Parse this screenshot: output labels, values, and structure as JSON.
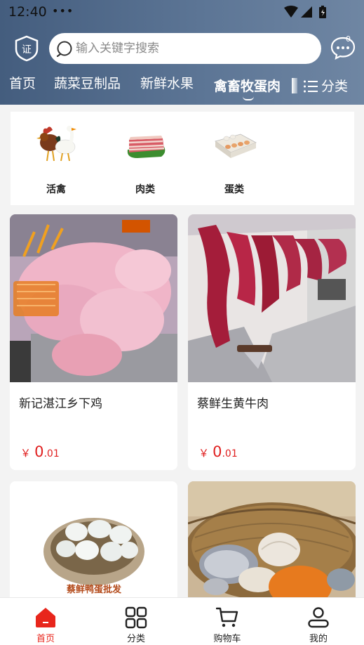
{
  "status_bar": {
    "time": "12:40",
    "dots": "•••"
  },
  "search": {
    "placeholder": "输入关键字搜索"
  },
  "message": {
    "badge": "0"
  },
  "tabs": [
    {
      "label": "首页"
    },
    {
      "label": "蔬菜豆制品"
    },
    {
      "label": "新鲜水果"
    },
    {
      "label": "禽畜牧蛋肉"
    }
  ],
  "category_button": {
    "label": "分类"
  },
  "categories": [
    {
      "label": "活禽",
      "icon": "poultry-icon"
    },
    {
      "label": "肉类",
      "icon": "meat-icon"
    },
    {
      "label": "蛋类",
      "icon": "eggs-icon"
    }
  ],
  "products": [
    {
      "title": "新记湛江乡下鸡",
      "currency": "￥",
      "price_int": "0",
      "price_dec": ".01"
    },
    {
      "title": "蔡鲜生黄牛肉",
      "currency": "￥",
      "price_int": "0",
      "price_dec": ".01"
    },
    {
      "title": "",
      "currency": "",
      "price_int": "",
      "price_dec": ""
    },
    {
      "title": "",
      "currency": "",
      "price_int": "",
      "price_dec": ""
    }
  ],
  "product_image_text": "蔡鲜鸭蛋批发",
  "bottom_nav": [
    {
      "label": "首页",
      "icon": "home-icon"
    },
    {
      "label": "分类",
      "icon": "grid-icon"
    },
    {
      "label": "购物车",
      "icon": "cart-icon"
    },
    {
      "label": "我的",
      "icon": "user-icon"
    }
  ],
  "colors": {
    "header": "#50698a",
    "accent": "#e8261c",
    "price": "#e02020"
  }
}
